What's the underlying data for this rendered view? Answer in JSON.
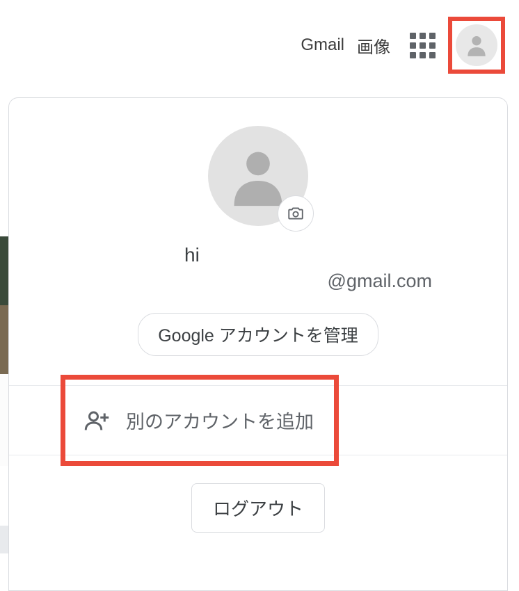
{
  "nav": {
    "gmail": "Gmail",
    "images": "画像"
  },
  "account": {
    "name": "hi",
    "email": "@gmail.com",
    "manage_label": "Google アカウントを管理",
    "add_account_label": "別のアカウントを追加",
    "sign_out_label": "ログアウト"
  },
  "colors": {
    "highlight": "#eb4a3a"
  }
}
